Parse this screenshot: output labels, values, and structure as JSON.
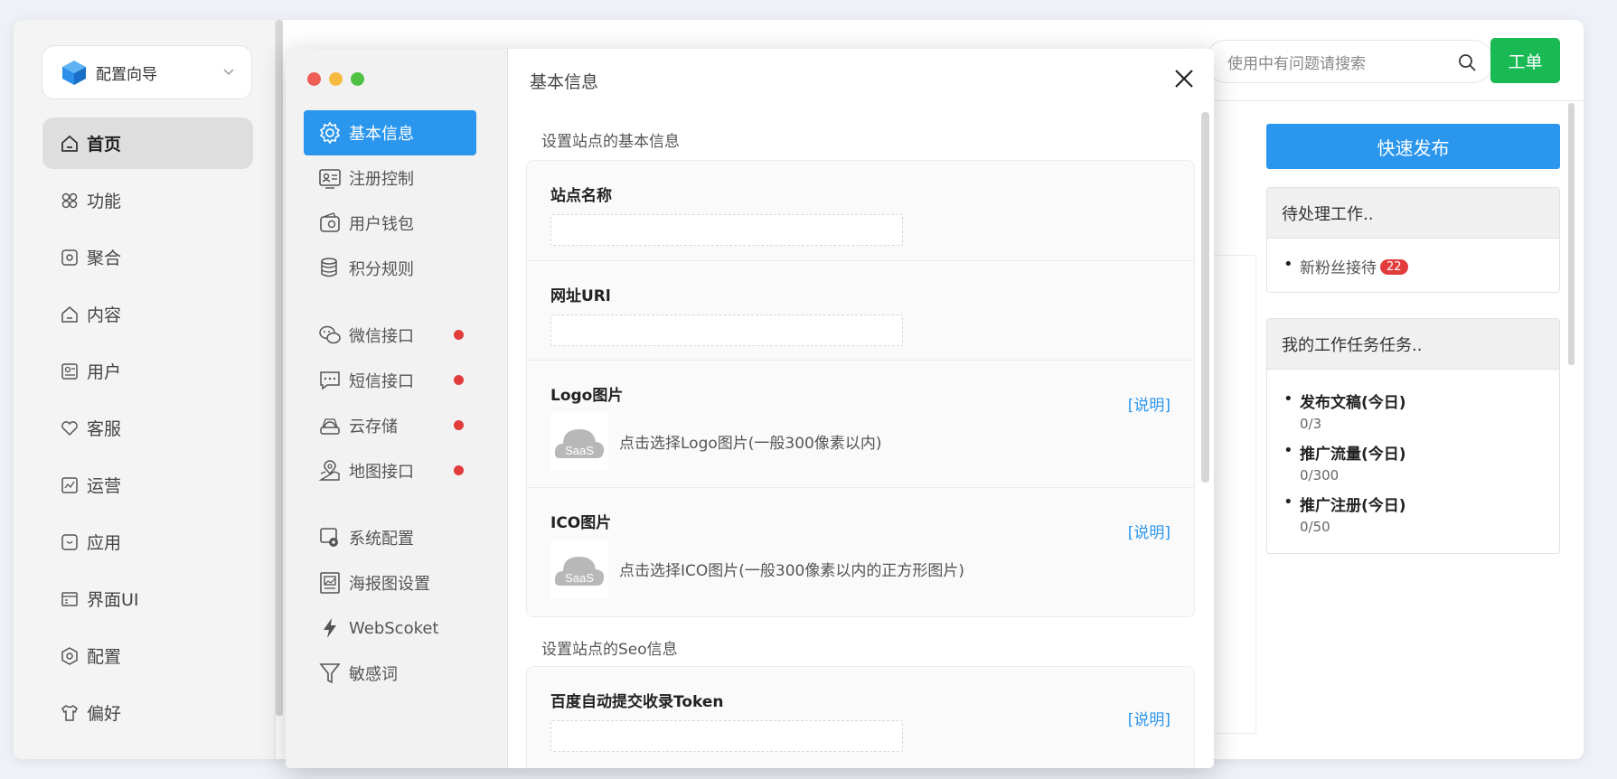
{
  "background_app": {
    "wizard_label": "配置向导",
    "nav": [
      {
        "label": "首页",
        "icon": "home-icon",
        "active": true
      },
      {
        "label": "功能",
        "icon": "grid-icon"
      },
      {
        "label": "聚合",
        "icon": "aggregate-icon"
      },
      {
        "label": "内容",
        "icon": "content-icon"
      },
      {
        "label": "用户",
        "icon": "user-card-icon"
      },
      {
        "label": "客服",
        "icon": "heart-icon"
      },
      {
        "label": "运营",
        "icon": "chart-icon"
      },
      {
        "label": "应用",
        "icon": "app-icon"
      },
      {
        "label": "界面UI",
        "icon": "layout-icon"
      },
      {
        "label": "配置",
        "icon": "config-icon"
      },
      {
        "label": "偏好",
        "icon": "shirt-icon"
      }
    ],
    "search_placeholder": "使用中有问题请搜索",
    "ticket_label": "工单",
    "publish_label": "快速发布",
    "pending": {
      "title": "待处理工作..",
      "item": "新粉丝接待",
      "count": "22"
    },
    "tasks": {
      "title": "我的工作任务任务..",
      "items": [
        {
          "name": "发布文稿(今日)",
          "progress": "0/3"
        },
        {
          "name": "推广流量(今日)",
          "progress": "0/300"
        },
        {
          "name": "推广注册(今日)",
          "progress": "0/50"
        }
      ]
    }
  },
  "modal": {
    "title": "基本信息",
    "menu": [
      {
        "label": "基本信息",
        "icon": "gear-icon",
        "active": true
      },
      {
        "label": "注册控制",
        "icon": "id-card-icon"
      },
      {
        "label": "用户钱包",
        "icon": "wallet-icon"
      },
      {
        "label": "积分规则",
        "icon": "database-icon"
      },
      {
        "label": "微信接口",
        "icon": "wechat-icon",
        "alert": true
      },
      {
        "label": "短信接口",
        "icon": "message-icon",
        "alert": true
      },
      {
        "label": "云存储",
        "icon": "cloud-storage-icon",
        "alert": true
      },
      {
        "label": "地图接口",
        "icon": "map-pin-icon",
        "alert": true
      },
      {
        "label": "系统配置",
        "icon": "system-config-icon"
      },
      {
        "label": "海报图设置",
        "icon": "poster-icon"
      },
      {
        "label": "WebScoket",
        "icon": "lightning-icon"
      },
      {
        "label": "敏感词",
        "icon": "filter-icon"
      }
    ],
    "section_basic": "设置站点的基本信息",
    "section_seo": "设置站点的Seo信息",
    "fields": {
      "site_name": "站点名称",
      "site_url": "网址URl",
      "logo": "Logo图片",
      "logo_hint": "点击选择Logo图片(一般300像素以内)",
      "ico": "ICO图片",
      "ico_hint": "点击选择ICO图片(一般300像素以内的正方形图片)",
      "baidu_token": "百度自动提交收录Token"
    },
    "explain_label": "[说明]",
    "saas_text": "SaaS"
  },
  "colors": {
    "accent": "#2b96ee",
    "green": "#19b954",
    "alert": "#e23b3b",
    "mac_red": "#ee5e55",
    "mac_yellow": "#f6bb3e",
    "mac_green": "#4fc244"
  }
}
